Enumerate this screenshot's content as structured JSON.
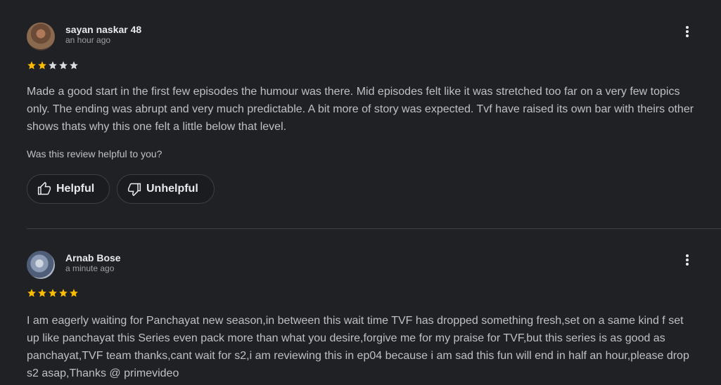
{
  "reviews": [
    {
      "author": "sayan naskar 48",
      "time": "an hour ago",
      "rating": 2,
      "rating_max": 5,
      "text": "Made a good start in the first few episodes the humour was there. Mid episodes felt like it was stretched too far on a very few topics only. The ending was abrupt and very much predictable. A bit more of story was expected. Tvf have raised its own bar with theirs other shows thats why this one felt a little below that level.",
      "helpful_question": "Was this review helpful to you?",
      "helpful_label": "Helpful",
      "unhelpful_label": "Unhelpful"
    },
    {
      "author": "Arnab Bose",
      "time": "a minute ago",
      "rating": 5,
      "rating_max": 5,
      "text": "I am eagerly waiting for Panchayat new season,in between this wait time TVF has dropped something fresh,set on a same kind f set up like panchayat this Series even pack more than what you desire,forgive me for my praise for TVF,but this series is as good as panchayat,TVF team thanks,cant wait for s2,i am reviewing this in ep04 because i am sad this fun will end in half an hour,please drop s2 asap,Thanks @ primevideo"
    }
  ],
  "colors": {
    "background": "#202124",
    "star_filled": "#fbbc04",
    "star_empty": "#dadce0"
  }
}
